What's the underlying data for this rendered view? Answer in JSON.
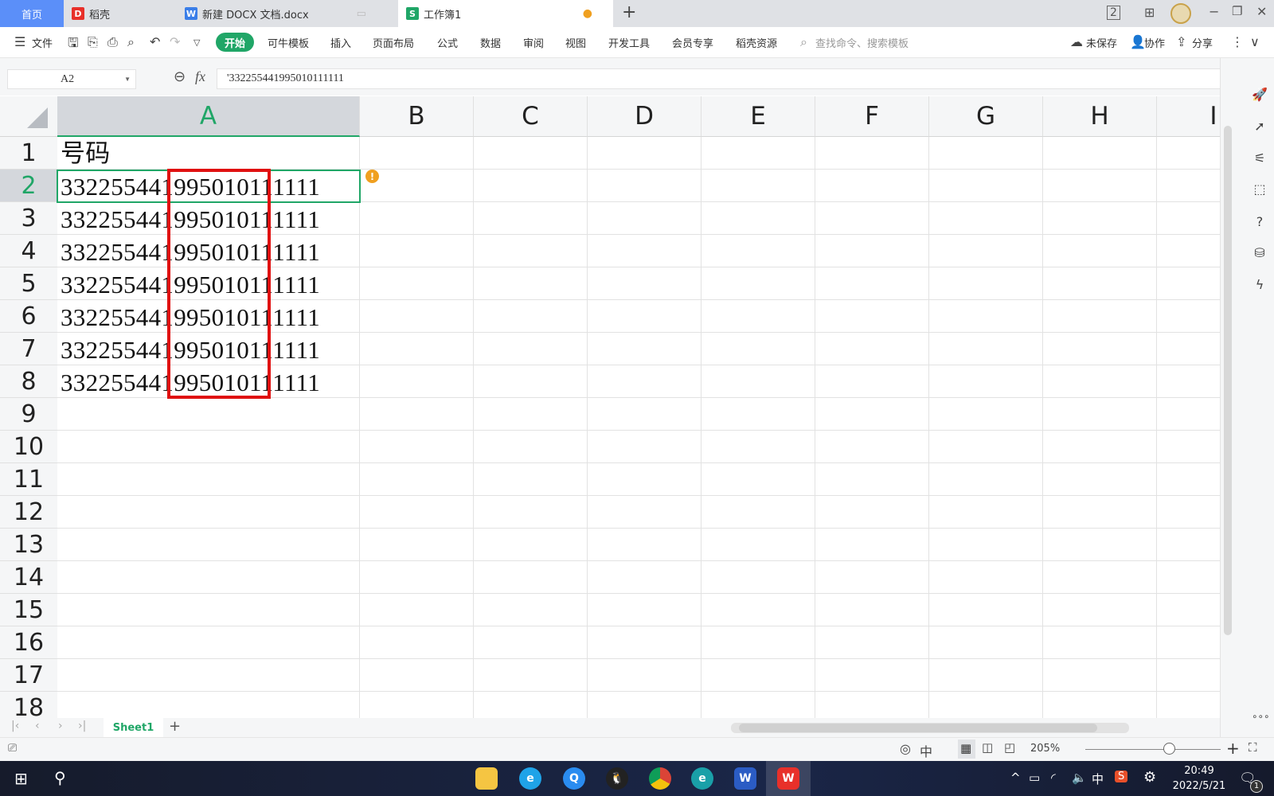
{
  "tabs": [
    {
      "label": "首页"
    },
    {
      "label": "稻壳"
    },
    {
      "label": "新建 DOCX 文档.docx"
    },
    {
      "label": "工作簿1"
    }
  ],
  "menu": {
    "file": "文件",
    "items": [
      "开始",
      "可牛模板",
      "插入",
      "页面布局",
      "公式",
      "数据",
      "审阅",
      "视图",
      "开发工具",
      "会员专享",
      "稻壳资源"
    ],
    "search_placeholder": "查找命令、搜索模板",
    "unsaved": "未保存",
    "collab": "协作",
    "share": "分享"
  },
  "formula_bar": {
    "cell_ref": "A2",
    "fx": "fx",
    "value": "'332255441995010111111"
  },
  "grid": {
    "columns": [
      "A",
      "B",
      "C",
      "D",
      "E",
      "F",
      "G",
      "H",
      "I"
    ],
    "selected_column": "A",
    "selected_row": 2,
    "rows": [
      "1",
      "2",
      "3",
      "4",
      "5",
      "6",
      "7",
      "8",
      "9",
      "10",
      "11",
      "12",
      "13",
      "14",
      "15",
      "16",
      "17",
      "18"
    ],
    "cells": [
      "号码",
      "332255441995010111111",
      "332255441995010111111",
      "332255441995010111111",
      "332255441995010111111",
      "332255441995010111111",
      "332255441995010111111",
      "332255441995010111111"
    ]
  },
  "highlight": {
    "color": "#e01010",
    "text": "1995010"
  },
  "sheets": {
    "active": "Sheet1"
  },
  "status": {
    "zoom": "205%",
    "zoom_level": 0.62
  },
  "taskbar": {
    "time": "20:49",
    "date": "2022/5/21",
    "ime": "中",
    "notifications": "1"
  },
  "colors": {
    "accent": "#20a667",
    "tab_home": "#5b8ff9"
  }
}
